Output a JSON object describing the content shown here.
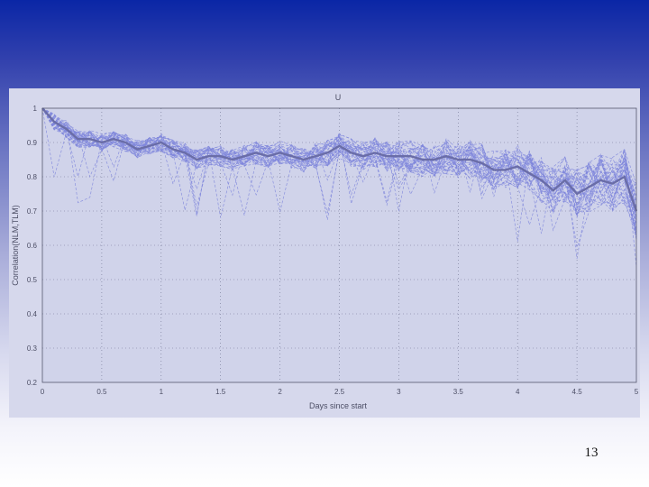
{
  "slide": {
    "number": "13"
  },
  "chart_data": {
    "type": "line",
    "title": "U",
    "xlabel": "Days since start",
    "ylabel": "Correlation(NLM,TLM)",
    "xlim": [
      0,
      5
    ],
    "ylim": [
      0.2,
      1
    ],
    "xticks": [
      0,
      0.5,
      1,
      1.5,
      2,
      2.5,
      3,
      3.5,
      4,
      4.5,
      5
    ],
    "xtick_labels": [
      "0",
      "0.5",
      "1",
      "1.5",
      "2",
      "2.5",
      "3",
      "3.5",
      "4",
      "4.5",
      "5"
    ],
    "yticks": [
      0.2,
      0.3,
      0.4,
      0.5,
      0.6,
      0.7,
      0.8,
      0.9,
      1
    ],
    "ytick_labels": [
      "0.2",
      "0.3",
      "0.4",
      "0.5",
      "0.6",
      "0.7",
      "0.8",
      "0.9",
      "1"
    ],
    "grid": true,
    "colors": {
      "ensemble": "#7f86dc",
      "mean": "#6a6da8",
      "grid": "#6f7390",
      "axes": "#55586e"
    },
    "ensemble_members": 40,
    "series": [
      {
        "style": "bold-mean",
        "x": [
          0,
          0.1,
          0.2,
          0.3,
          0.4,
          0.5,
          0.6,
          0.7,
          0.8,
          0.9,
          1,
          1.1,
          1.2,
          1.3,
          1.4,
          1.5,
          1.6,
          1.7,
          1.8,
          1.9,
          2,
          2.1,
          2.2,
          2.3,
          2.4,
          2.5,
          2.6,
          2.7,
          2.8,
          2.9,
          3,
          3.1,
          3.2,
          3.3,
          3.4,
          3.5,
          3.6,
          3.7,
          3.8,
          3.9,
          4,
          4.1,
          4.2,
          4.3,
          4.4,
          4.5,
          4.6,
          4.7,
          4.8,
          4.9,
          5
        ],
        "y": [
          1,
          0.96,
          0.94,
          0.91,
          0.91,
          0.9,
          0.91,
          0.9,
          0.88,
          0.89,
          0.9,
          0.88,
          0.87,
          0.85,
          0.86,
          0.86,
          0.85,
          0.86,
          0.87,
          0.86,
          0.87,
          0.86,
          0.85,
          0.86,
          0.87,
          0.89,
          0.87,
          0.86,
          0.87,
          0.86,
          0.86,
          0.86,
          0.85,
          0.85,
          0.86,
          0.85,
          0.85,
          0.84,
          0.82,
          0.82,
          0.83,
          0.81,
          0.79,
          0.76,
          0.79,
          0.75,
          0.77,
          0.79,
          0.78,
          0.8,
          0.7
        ]
      }
    ]
  }
}
